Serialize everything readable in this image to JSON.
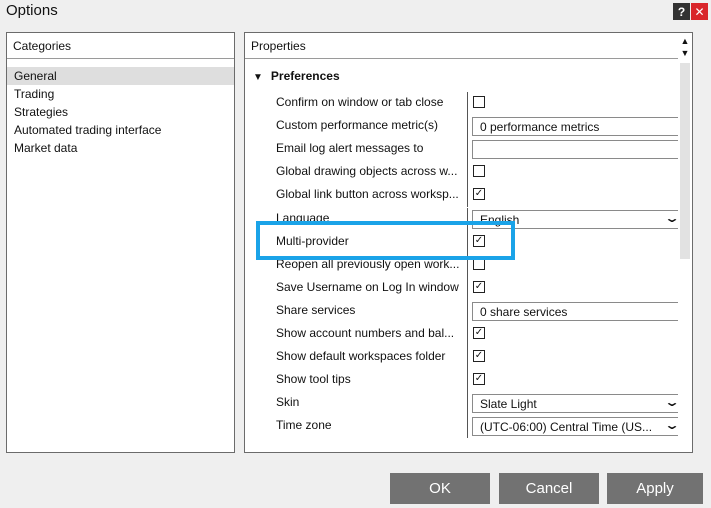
{
  "window": {
    "title": "Options",
    "help_label": "?",
    "close_label": "✕"
  },
  "categories": {
    "header": "Categories",
    "items": [
      {
        "label": "General",
        "selected": true
      },
      {
        "label": "Trading"
      },
      {
        "label": "Strategies"
      },
      {
        "label": "Automated trading interface"
      },
      {
        "label": "Market data"
      }
    ]
  },
  "properties": {
    "header": "Properties",
    "section": "Preferences",
    "section_icon": "triangle-down-icon",
    "rows": [
      {
        "label": "Confirm on window or tab close",
        "type": "checkbox",
        "checked": false,
        "mark": ""
      },
      {
        "label": "Custom performance metric(s)",
        "type": "text",
        "value": "0 performance metrics"
      },
      {
        "label": "Email log alert messages to",
        "type": "text",
        "value": ""
      },
      {
        "label": "Global drawing objects across w...",
        "type": "checkbox",
        "checked": false,
        "mark": ""
      },
      {
        "label": "Global link button across worksp...",
        "type": "checkbox",
        "checked": true,
        "mark": "✓"
      },
      {
        "label": "Language",
        "type": "select",
        "value": "English"
      },
      {
        "label": "Multi-provider",
        "type": "checkbox",
        "checked": true,
        "mark": "✓"
      },
      {
        "label": "Reopen all previously open work...",
        "type": "checkbox",
        "checked": false,
        "mark": ""
      },
      {
        "label": "Save Username on Log In window",
        "type": "checkbox",
        "checked": true,
        "mark": "✓"
      },
      {
        "label": "Share services",
        "type": "text",
        "value": "0 share services"
      },
      {
        "label": "Show account numbers and bal...",
        "type": "checkbox",
        "checked": true,
        "mark": "✓"
      },
      {
        "label": "Show default workspaces folder",
        "type": "checkbox",
        "checked": true,
        "mark": "✓"
      },
      {
        "label": "Show tool tips",
        "type": "checkbox",
        "checked": true,
        "mark": "✓"
      },
      {
        "label": "Skin",
        "type": "select",
        "value": "Slate Light"
      },
      {
        "label": "Time zone",
        "type": "select",
        "value": "(UTC-06:00) Central Time (US..."
      }
    ],
    "chevron": "❯"
  },
  "highlight_color": "#1aa3e8",
  "buttons": {
    "ok": "OK",
    "cancel": "Cancel",
    "apply": "Apply"
  }
}
